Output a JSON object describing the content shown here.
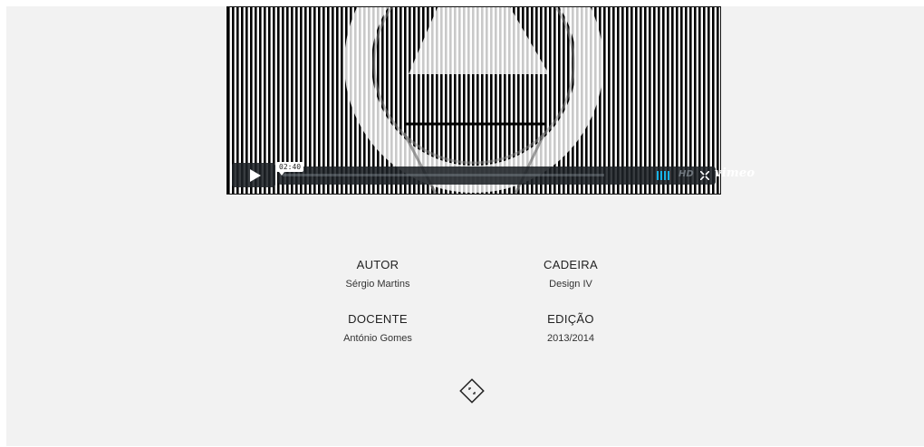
{
  "player": {
    "time": "02:40",
    "progress": 0.0,
    "hd_label": "HD",
    "brand": "vimeo",
    "accent": "#19b3e6",
    "icons": [
      "play-icon",
      "volume-icon",
      "fullscreen-icon",
      "vimeo-logo"
    ]
  },
  "info": {
    "autor_label": "AUTOR",
    "autor_value": "Sérgio Martins",
    "cadeira_label": "CADEIRA",
    "cadeira_value": "Design IV",
    "docente_label": "DOCENTE",
    "docente_value": "António Gomes",
    "edicao_label": "EDIÇÃO",
    "edicao_value": "2013/2014"
  },
  "footer": {
    "icon": "diamond-expand-icon"
  }
}
